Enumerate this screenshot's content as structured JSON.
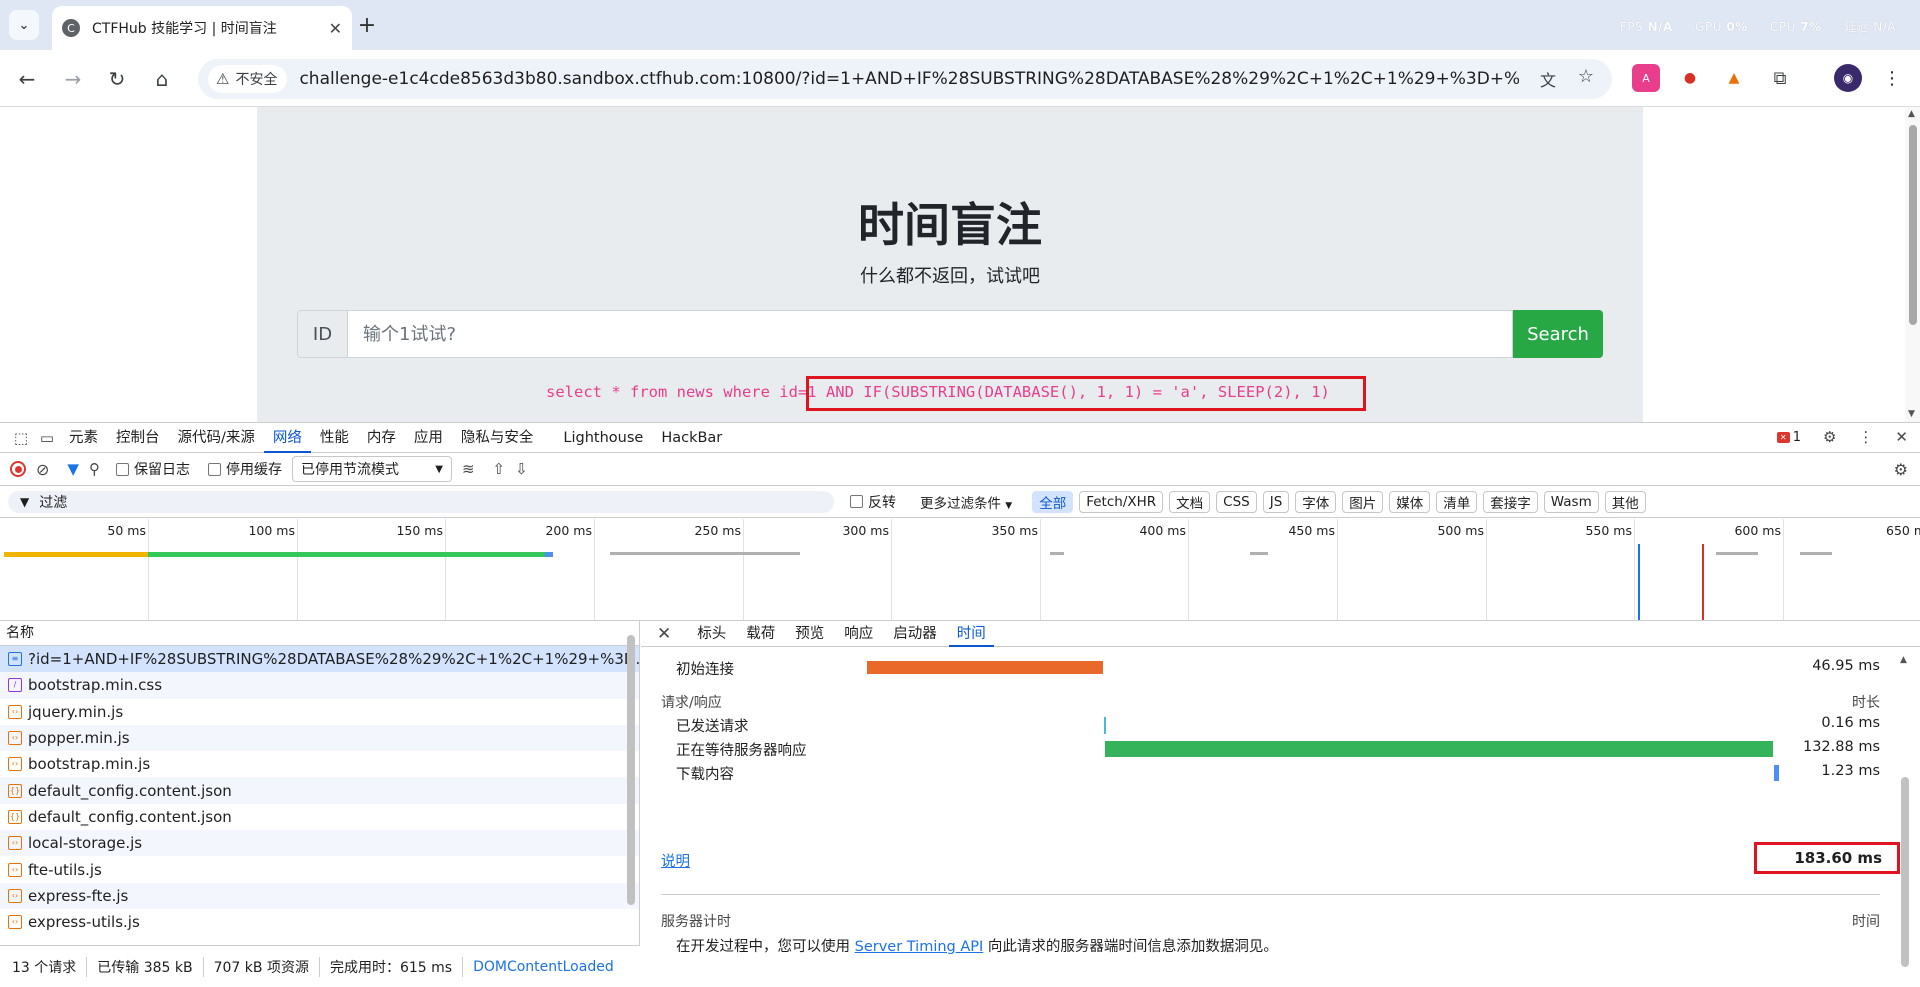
{
  "browser": {
    "tab_title": "CTFHub 技能学习 | 时间盲注",
    "tab_favicon": "C",
    "security_label": "不安全",
    "url": "challenge-e1c4cde8563d3b80.sandbox.ctfhub.com:10800/?id=1+AND+IF%28SUBSTRING%28DATABASE%28%29%2C+1%2C+1%29+%3D+%27...",
    "overlay": {
      "fps_label": "FPS",
      "fps_value": "N/A",
      "gpu_label": "GPU",
      "gpu_value": "0%",
      "cpu_label": "CPU",
      "cpu_value": "7%",
      "extra": "延迟 N/A"
    }
  },
  "page": {
    "title": "时间盲注",
    "subtitle": "什么都不返回，试试吧",
    "id_label": "ID",
    "input_placeholder": "输个1试试?",
    "search_label": "Search",
    "sql": "select * from news where id=1 AND IF(SUBSTRING(DATABASE(), 1, 1) = 'a', SLEEP(2), 1)"
  },
  "devtools": {
    "tabs": [
      "元素",
      "控制台",
      "源代码/来源",
      "网络",
      "性能",
      "内存",
      "应用",
      "隐私与安全",
      "Lighthouse",
      "HackBar"
    ],
    "active_tab": "网络",
    "error_count": "1",
    "toolbar": {
      "preserve_log": "保留日志",
      "disable_cache": "停用缓存",
      "throttle": "已停用节流模式"
    },
    "filter": {
      "placeholder": "过滤",
      "invert": "反转",
      "more": "更多过滤条件",
      "types": [
        "全部",
        "Fetch/XHR",
        "文档",
        "CSS",
        "JS",
        "字体",
        "图片",
        "媒体",
        "清单",
        "套接字",
        "Wasm",
        "其他"
      ]
    },
    "overview_ticks": [
      "50 ms",
      "100 ms",
      "150 ms",
      "200 ms",
      "250 ms",
      "300 ms",
      "350 ms",
      "400 ms",
      "450 ms",
      "500 ms",
      "550 ms",
      "600 ms",
      "650 ms"
    ],
    "list_header": "名称",
    "requests": [
      "?id=1+AND+IF%28SUBSTRING%28DATABASE%28%29%2C+1%2C+1%29+%3D...",
      "bootstrap.min.css",
      "jquery.min.js",
      "popper.min.js",
      "bootstrap.min.js",
      "default_config.content.json",
      "default_config.content.json",
      "local-storage.js",
      "fte-utils.js",
      "express-fte.js",
      "express-utils.js"
    ],
    "status": {
      "requests": "13 个请求",
      "transferred": "已传输 385 kB",
      "resources": "707 kB 项资源",
      "finish": "完成用时：615 ms",
      "dcl": "DOMContentLoaded"
    },
    "detail_tabs": [
      "标头",
      "载荷",
      "预览",
      "响应",
      "启动器",
      "时间"
    ],
    "detail_active": "时间",
    "timing": {
      "initial_connection_label": "初始连接",
      "initial_connection_value": "46.95 ms",
      "section_label": "请求/响应",
      "section_right": "时长",
      "sent_label": "已发送请求",
      "sent_value": "0.16 ms",
      "waiting_label": "正在等待服务器响应",
      "waiting_value": "132.88 ms",
      "download_label": "下载内容",
      "download_value": "1.23 ms",
      "explain_link": "说明",
      "total": "183.60 ms",
      "server_timing_label": "服务器计时",
      "server_timing_right": "时间",
      "server_timing_text_before": "在开发过程中，您可以使用",
      "server_timing_link": "Server Timing API",
      "server_timing_text_after": "向此请求的服务器端时间信息添加数据洞见。"
    }
  }
}
